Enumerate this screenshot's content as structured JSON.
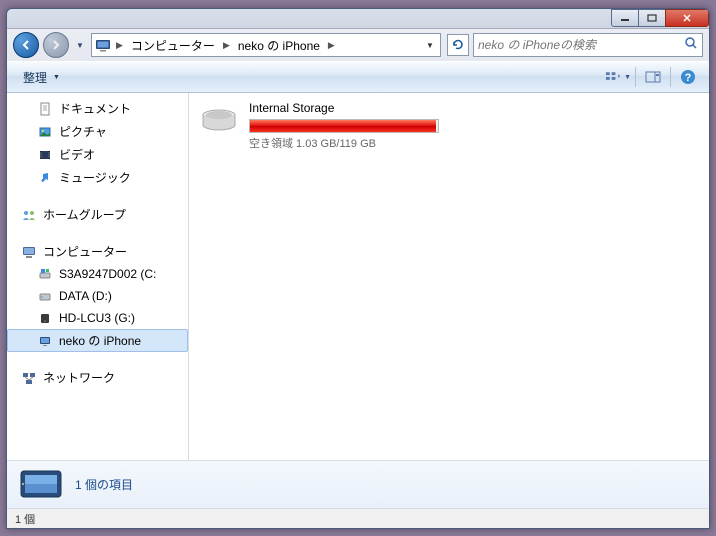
{
  "window": {
    "titlebar": {
      "minimize": "min",
      "maximize": "max",
      "close": "close"
    }
  },
  "nav": {
    "back_label": "back",
    "forward_label": "forward"
  },
  "address": {
    "icon": "device-icon",
    "crumbs": [
      "コンピューター",
      "neko の iPhone"
    ],
    "refresh_label": "refresh"
  },
  "search": {
    "placeholder": "neko の iPhoneの検索"
  },
  "toolbar": {
    "organize_label": "整理",
    "view_label": "view",
    "preview_label": "preview",
    "help_label": "help"
  },
  "sidebar": {
    "libraries": [
      {
        "icon": "doc",
        "label": "ドキュメント"
      },
      {
        "icon": "pic",
        "label": "ピクチャ"
      },
      {
        "icon": "vid",
        "label": "ビデオ"
      },
      {
        "icon": "mus",
        "label": "ミュージック"
      }
    ],
    "homegroup": {
      "icon": "homegroup",
      "label": "ホームグループ"
    },
    "computer": {
      "icon": "computer",
      "label": "コンピューター",
      "children": [
        {
          "icon": "hdd-win",
          "label": "S3A9247D002 (C:"
        },
        {
          "icon": "hdd",
          "label": "DATA (D:)"
        },
        {
          "icon": "hdd-ext",
          "label": "HD-LCU3 (G:)"
        },
        {
          "icon": "device",
          "label": "neko の iPhone",
          "selected": true
        }
      ]
    },
    "network": {
      "icon": "network",
      "label": "ネットワーク"
    }
  },
  "main": {
    "storage": {
      "name": "Internal Storage",
      "fill_percent": 99.1,
      "free_text": "空き領域 1.03 GB/119 GB"
    }
  },
  "details": {
    "count_text": "1 個の項目"
  },
  "status": {
    "text": "1 個"
  }
}
